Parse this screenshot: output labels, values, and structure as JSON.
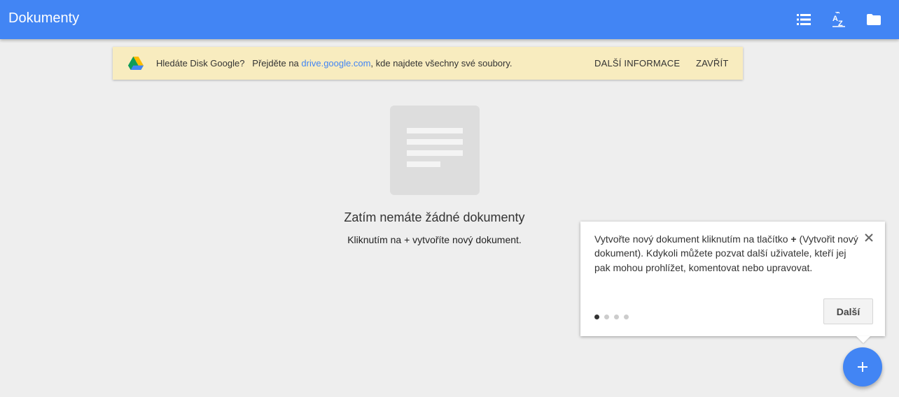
{
  "appbar": {
    "title": "Dokumenty",
    "icons": [
      "list-view-icon",
      "sort-az-icon",
      "folder-icon"
    ],
    "color": "#4285f4"
  },
  "banner": {
    "text_before": "Hledáte Disk Google?   Přejděte na ",
    "link": "drive.google.com",
    "text_after": ", kde najdete všechny své soubory.",
    "learn_more": "DALŠÍ INFORMACE",
    "close": "ZAVŘÍT",
    "background": "#f8ecbf"
  },
  "empty_state": {
    "title": "Zatím nemáte žádné dokumenty",
    "subtitle": "Kliknutím na + vytvoříte nový dokument."
  },
  "tooltip": {
    "text_before": "Vytvořte nový dokument kliknutím na tlačítko ",
    "plus": "+",
    "text_after": " (Vytvořit nový dokument). Kdykoli můžete pozvat další uživatele, kteří jej pak mohou prohlížet, komentovat nebo upravovat.",
    "next_button": "Další",
    "steps_total": 4,
    "step_current": 1
  },
  "fab": {
    "label": "+",
    "color": "#4285f4"
  }
}
